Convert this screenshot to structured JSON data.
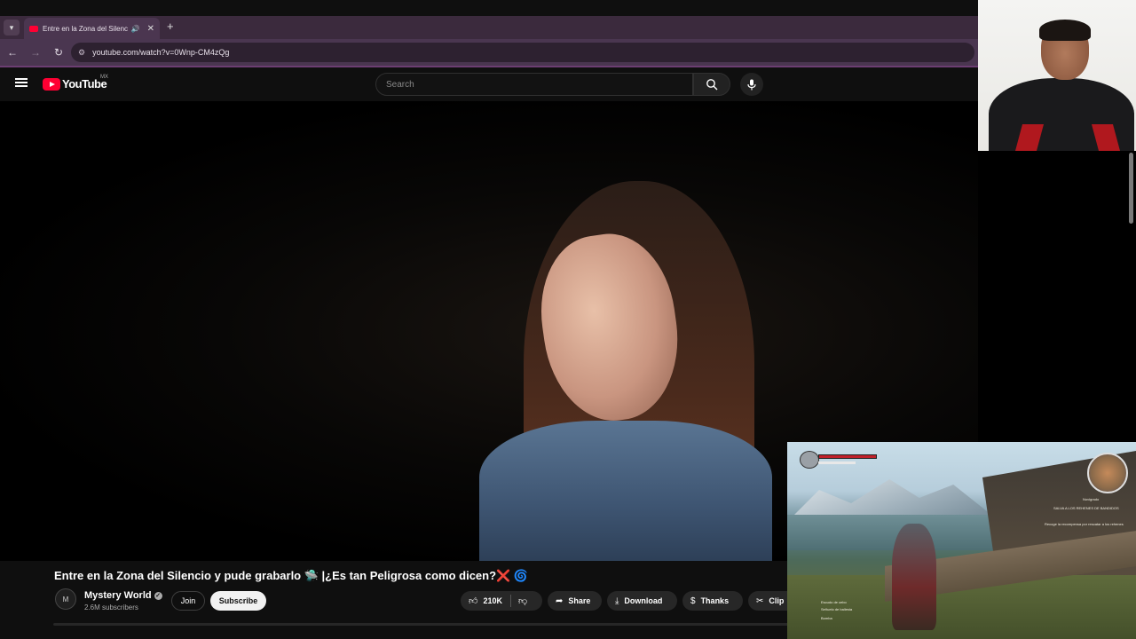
{
  "browser": {
    "tab_title": "Entre en la Zona del Silencio y pude grabarlo",
    "tab_close": "✕",
    "new_tab": "+",
    "url": "youtube.com/watch?v=0Wnp-CM4zQg"
  },
  "youtube": {
    "logo_text": "YouTube",
    "country_code": "MX",
    "search_placeholder": "Search"
  },
  "video": {
    "title": "Entre en la Zona del Silencio y pude grabarlo 🛸 |¿Es tan Peligrosa como dicen?❌ 🌀",
    "channel_name": "Mystery World",
    "channel_avatar_initials": "M",
    "subscribers": "2.6M subscribers",
    "join_label": "Join",
    "subscribe_label": "Subscribe",
    "likes": "210K",
    "share_label": "Share",
    "download_label": "Download",
    "thanks_label": "Thanks",
    "clip_label": "Clip"
  },
  "game_hud": {
    "quest_header": "SALVA A LOS REHENES DE BANDIDOS",
    "quest_objective": "Recoge la recompensa por rescatar a los rehenes",
    "region": "Novigrado",
    "item_1": "Escudo de cebo",
    "item_2": "Señuelo de ballesta",
    "item_3": "Bomba"
  },
  "colors": {
    "youtube_red": "#ff0033",
    "chrome_tab_purple": "#4a3650",
    "page_background": "#0f0f0f"
  }
}
